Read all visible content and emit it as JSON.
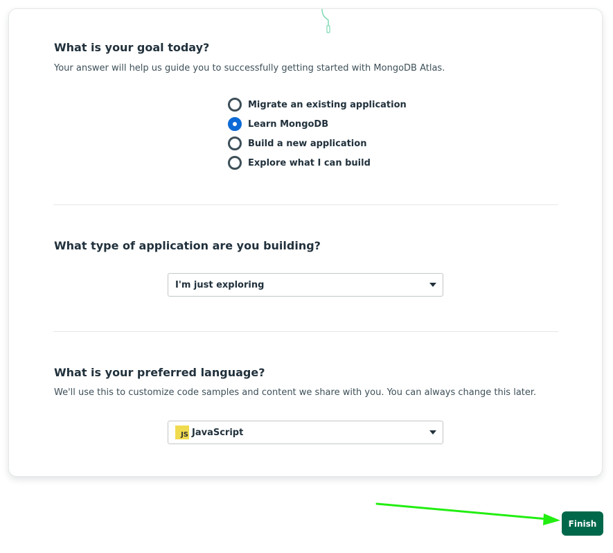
{
  "goal": {
    "title": "What is your goal today?",
    "description": "Your answer will help us guide you to successfully getting started with MongoDB Atlas.",
    "options": [
      {
        "label": "Migrate an existing application",
        "checked": false
      },
      {
        "label": "Learn MongoDB",
        "checked": true
      },
      {
        "label": "Build a new application",
        "checked": false
      },
      {
        "label": "Explore what I can build",
        "checked": false
      }
    ]
  },
  "app_type": {
    "title": "What type of application are you building?",
    "selected": "I'm just exploring"
  },
  "language": {
    "title": "What is your preferred language?",
    "description": "We'll use this to customize code samples and content we share with you. You can always change this later.",
    "selected": "JavaScript",
    "icon": "js-icon",
    "icon_text": "JS"
  },
  "footer": {
    "finish_label": "Finish"
  },
  "colors": {
    "accent_blue": "#0d6ad6",
    "finish_green": "#00684a",
    "annotation_arrow": "#22ee11"
  }
}
